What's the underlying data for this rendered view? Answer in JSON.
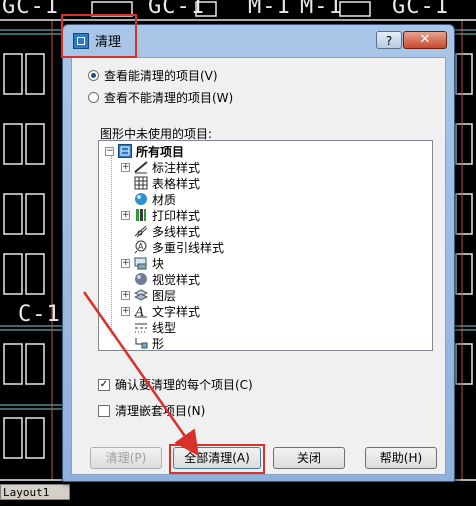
{
  "background": {
    "labels": [
      "GC-1",
      "GC-1",
      "M-1",
      "M-1",
      "GC-1",
      "C-1"
    ],
    "layout_tab": "Layout1"
  },
  "dialog": {
    "title": "清理",
    "help_button": "?",
    "close_button": "✕",
    "radio_options": [
      {
        "label": "查看能清理的项目(V)",
        "checked": true
      },
      {
        "label": "查看不能清理的项目(W)",
        "checked": false
      }
    ],
    "tree_caption": "图形中未使用的项目:",
    "tree_root": "所有项目",
    "tree_items": [
      {
        "label": "标注样式",
        "expandable": true,
        "icon": "dimension-style-icon"
      },
      {
        "label": "表格样式",
        "expandable": false,
        "icon": "table-style-icon"
      },
      {
        "label": "材质",
        "expandable": false,
        "icon": "material-icon"
      },
      {
        "label": "打印样式",
        "expandable": true,
        "icon": "plot-style-icon"
      },
      {
        "label": "多线样式",
        "expandable": false,
        "icon": "multiline-style-icon"
      },
      {
        "label": "多重引线样式",
        "expandable": false,
        "icon": "multileader-style-icon"
      },
      {
        "label": "块",
        "expandable": true,
        "icon": "block-icon"
      },
      {
        "label": "视觉样式",
        "expandable": false,
        "icon": "visual-style-icon"
      },
      {
        "label": "图层",
        "expandable": true,
        "icon": "layer-icon"
      },
      {
        "label": "文字样式",
        "expandable": true,
        "icon": "text-style-icon"
      },
      {
        "label": "线型",
        "expandable": false,
        "icon": "linetype-icon"
      },
      {
        "label": "形",
        "expandable": false,
        "icon": "shape-icon"
      }
    ],
    "checkboxes": [
      {
        "label": "确认要清理的每个项目(C)",
        "checked": true
      },
      {
        "label": "清理嵌套项目(N)",
        "checked": false
      }
    ],
    "buttons": {
      "purge": "清理(P)",
      "purge_all": "全部清理(A)",
      "close": "关闭",
      "help": "帮助(H)"
    }
  }
}
